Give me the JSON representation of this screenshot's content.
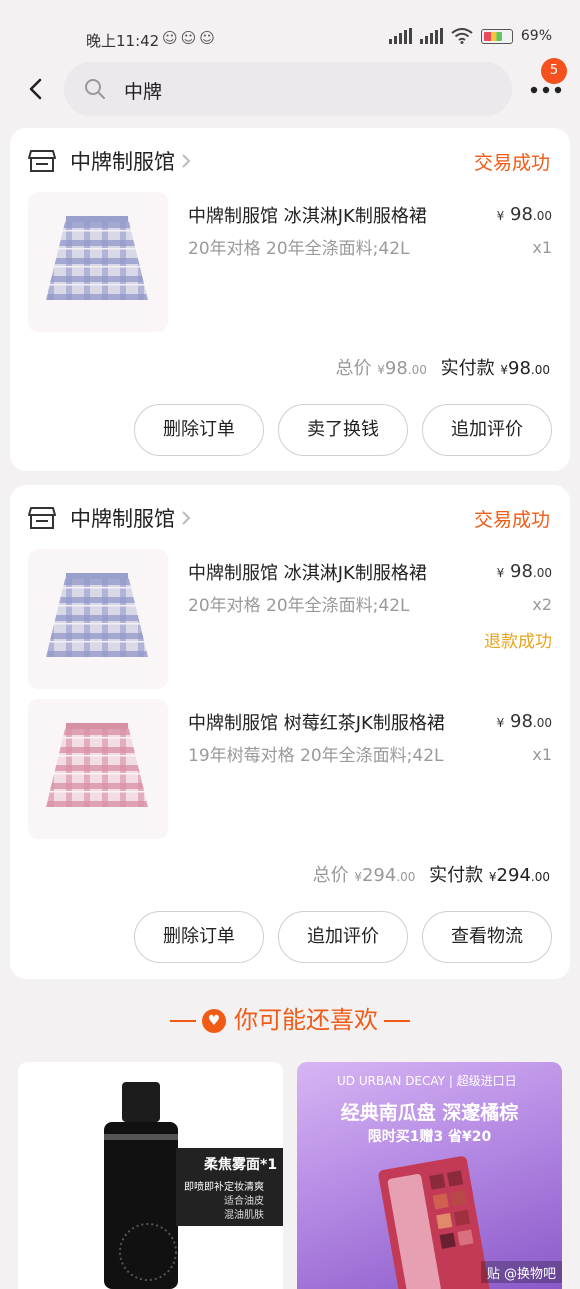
{
  "status_bar": {
    "time": "晚上11:42",
    "battery": "69%"
  },
  "header": {
    "search_query": "中牌",
    "notification_count": "5"
  },
  "orders": [
    {
      "shop": "中牌制服馆",
      "status": "交易成功",
      "items": [
        {
          "title": "中牌制服馆 冰淇淋JK制服格裙",
          "spec": "20年对格 20年全涤面料;42L",
          "price_symbol": "¥",
          "price_int": "98",
          "price_dec": ".00",
          "qty": "x1"
        }
      ],
      "total_label": "总价",
      "total_symbol": "¥",
      "total_int": "98",
      "total_dec": ".00",
      "paid_label": "实付款",
      "paid_symbol": "¥",
      "paid_int": "98",
      "paid_dec": ".00",
      "buttons": [
        "删除订单",
        "卖了换钱",
        "追加评价"
      ]
    },
    {
      "shop": "中牌制服馆",
      "status": "交易成功",
      "items": [
        {
          "title": "中牌制服馆 冰淇淋JK制服格裙",
          "spec": "20年对格 20年全涤面料;42L",
          "price_symbol": "¥",
          "price_int": "98",
          "price_dec": ".00",
          "qty": "x2",
          "refund": "退款成功"
        },
        {
          "title": "中牌制服馆 树莓红茶JK制服格裙",
          "spec": "19年树莓对格 20年全涤面料;42L",
          "price_symbol": "¥",
          "price_int": "98",
          "price_dec": ".00",
          "qty": "x1"
        }
      ],
      "total_label": "总价",
      "total_symbol": "¥",
      "total_int": "294",
      "total_dec": ".00",
      "paid_label": "实付款",
      "paid_symbol": "¥",
      "paid_int": "294",
      "paid_dec": ".00",
      "buttons": [
        "删除订单",
        "追加评价",
        "查看物流"
      ]
    }
  ],
  "recommend": {
    "title": "你可能还喜欢",
    "left_card": {
      "label_line1": "柔焦雾面*1",
      "label_line2": "即喷即补定妆清爽",
      "label_line3": "适合油皮",
      "label_line4": "混油肌肤"
    },
    "right_card": {
      "top": "UD URBAN DECAY | 超级进口日",
      "headline": "经典南瓜盘 深邃橘棕",
      "sub": "限时买1赠3 省¥20",
      "watermark": "贴 @换物吧"
    }
  },
  "colors": {
    "accent": "#f25b15",
    "refund": "#e6a51c",
    "background": "#f4f1f3"
  }
}
